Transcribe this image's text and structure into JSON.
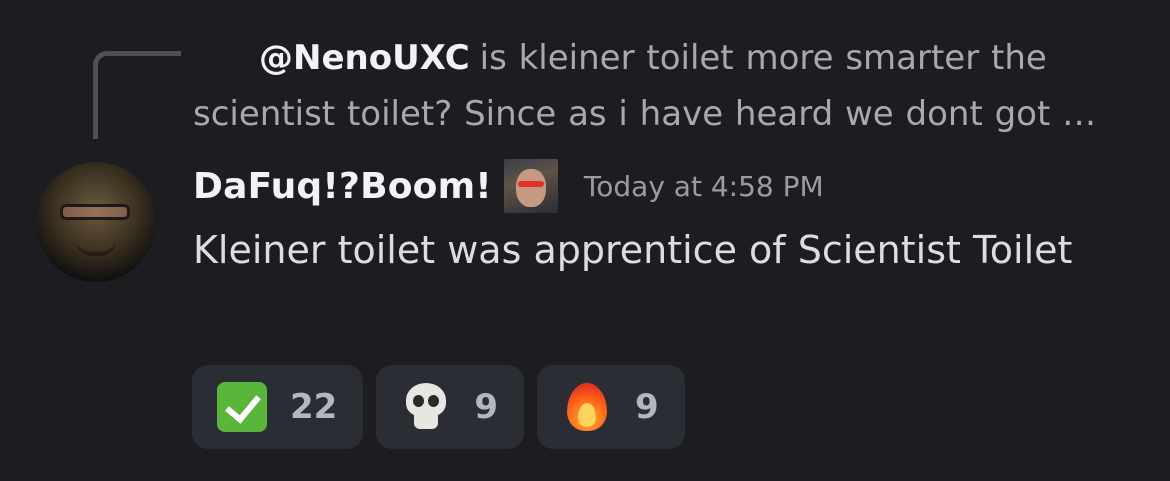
{
  "reply": {
    "mention": "@NenoUXC",
    "text": "is kleiner toilet more smarter the scientist toilet? Since as i have heard we dont got …"
  },
  "message": {
    "username": "DaFuq!?Boom!",
    "timestamp": "Today at 4:58 PM",
    "content": "Kleiner toilet was apprentice of Scientist Toilet"
  },
  "reactions": [
    {
      "emoji": "check-mark-button",
      "count": "22"
    },
    {
      "emoji": "skull",
      "count": "9"
    },
    {
      "emoji": "fire",
      "count": "9"
    }
  ],
  "colors": {
    "background": "#1c1c21",
    "reaction_bg": "#2b2d34",
    "username": "#f2f3f5",
    "message_text": "#dcdde1",
    "muted": "#9a9ca4"
  }
}
